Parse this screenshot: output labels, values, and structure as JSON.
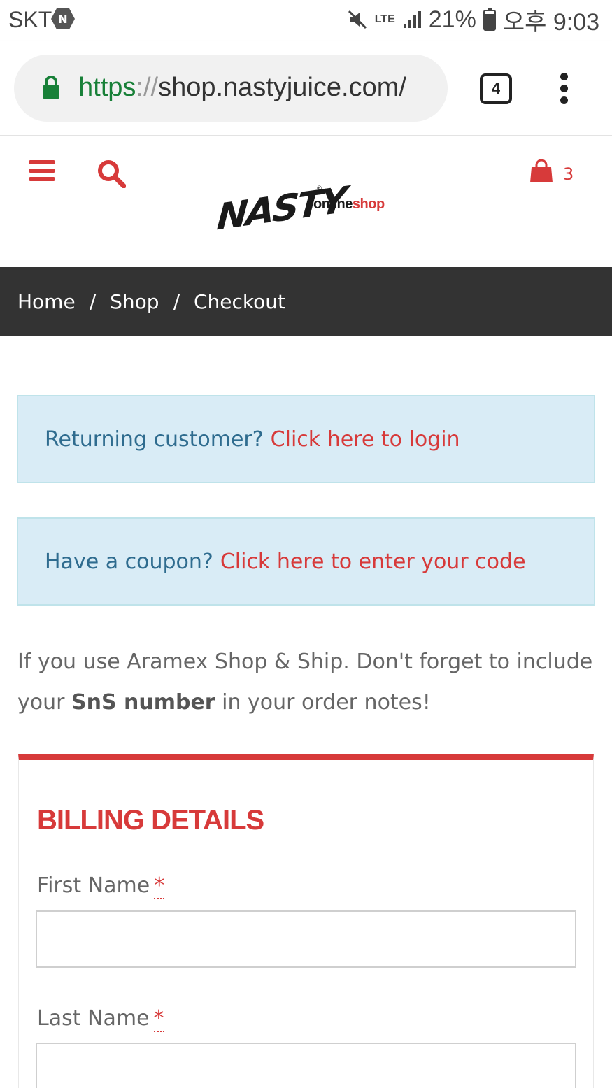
{
  "status_bar": {
    "carrier": "SKT",
    "network": "LTE",
    "battery": "21%",
    "time": "오후 9:03"
  },
  "browser": {
    "url_scheme": "https",
    "url_separator": "://",
    "url_host": "shop.nastyjuice.com/",
    "tab_count": "4"
  },
  "header": {
    "logo_main": "NASTY",
    "logo_online": "online",
    "logo_shop": "shop",
    "cart_count": "3"
  },
  "breadcrumb": {
    "items": [
      "Home",
      "Shop",
      "Checkout"
    ],
    "separator": "/"
  },
  "notices": {
    "login": {
      "question": "Returning customer?",
      "link": "Click here to login"
    },
    "coupon": {
      "question": "Have a coupon?",
      "link": "Click here to enter your code"
    }
  },
  "info": {
    "before": "If you use Aramex Shop & Ship. Don't forget to include your ",
    "bold": "SnS number",
    "after": " in your order notes!"
  },
  "billing": {
    "title": "BILLING DETAILS",
    "first_name_label": "First Name",
    "last_name_label": "Last Name",
    "required_mark": "*",
    "first_name_value": "",
    "last_name_value": ""
  },
  "colors": {
    "accent": "#d73a3a",
    "breadcrumb_bg": "#333333",
    "notice_bg": "#d9ecf6",
    "notice_text": "#2f6c8f"
  }
}
